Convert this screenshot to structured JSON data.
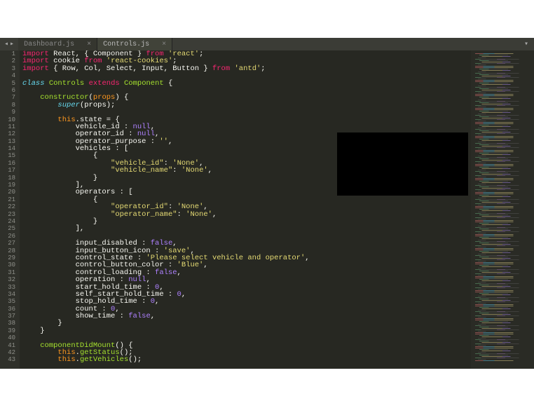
{
  "topbar": {
    "nav_left": "◂",
    "nav_right": "▸",
    "menu_icon": "▾"
  },
  "tabs": [
    {
      "label": "Dashboard.js",
      "close": "×",
      "active": false
    },
    {
      "label": "Controls.js",
      "close": "×",
      "active": true
    }
  ],
  "gutter_start": 1,
  "gutter_end": 43,
  "code_lines": [
    [
      [
        "kw",
        "import"
      ],
      [
        "punc",
        " React, { Component } "
      ],
      [
        "kw",
        "from"
      ],
      [
        "punc",
        " "
      ],
      [
        "str",
        "'react'"
      ],
      [
        "punc",
        ";"
      ]
    ],
    [
      [
        "kw",
        "import"
      ],
      [
        "punc",
        " cookie "
      ],
      [
        "kw",
        "from"
      ],
      [
        "punc",
        " "
      ],
      [
        "str",
        "'react-cookies'"
      ],
      [
        "punc",
        ";"
      ]
    ],
    [
      [
        "kw",
        "import"
      ],
      [
        "punc",
        " { Row, Col, Select, Input, Button } "
      ],
      [
        "kw",
        "from"
      ],
      [
        "punc",
        " "
      ],
      [
        "str",
        "'antd'"
      ],
      [
        "punc",
        ";"
      ]
    ],
    [],
    [
      [
        "kw2",
        "class"
      ],
      [
        "punc",
        " "
      ],
      [
        "cls",
        "Controls"
      ],
      [
        "punc",
        " "
      ],
      [
        "kw",
        "extends"
      ],
      [
        "punc",
        " "
      ],
      [
        "cls",
        "Component"
      ],
      [
        "punc",
        " {"
      ]
    ],
    [],
    [
      [
        "punc",
        "    "
      ],
      [
        "fnname",
        "constructor"
      ],
      [
        "punc",
        "("
      ],
      [
        "this",
        "props"
      ],
      [
        "punc",
        ") {"
      ]
    ],
    [
      [
        "punc",
        "        "
      ],
      [
        "kw2",
        "super"
      ],
      [
        "punc",
        "(props);"
      ]
    ],
    [],
    [
      [
        "punc",
        "        "
      ],
      [
        "this",
        "this"
      ],
      [
        "punc",
        ".state = {"
      ]
    ],
    [
      [
        "punc",
        "            vehicle_id : "
      ],
      [
        "bool",
        "null"
      ],
      [
        "punc",
        ","
      ]
    ],
    [
      [
        "punc",
        "            operator_id : "
      ],
      [
        "bool",
        "null"
      ],
      [
        "punc",
        ","
      ]
    ],
    [
      [
        "punc",
        "            operator_purpose : "
      ],
      [
        "str",
        "''"
      ],
      [
        "punc",
        ","
      ]
    ],
    [
      [
        "punc",
        "            vehicles : ["
      ]
    ],
    [
      [
        "punc",
        "                {"
      ]
    ],
    [
      [
        "punc",
        "                    "
      ],
      [
        "str",
        "\"vehicle_id\""
      ],
      [
        "punc",
        ": "
      ],
      [
        "str",
        "'None'"
      ],
      [
        "punc",
        ","
      ]
    ],
    [
      [
        "punc",
        "                    "
      ],
      [
        "str",
        "\"vehicle_name\""
      ],
      [
        "punc",
        ": "
      ],
      [
        "str",
        "'None'"
      ],
      [
        "punc",
        ","
      ]
    ],
    [
      [
        "punc",
        "                }"
      ]
    ],
    [
      [
        "punc",
        "            ],"
      ]
    ],
    [
      [
        "punc",
        "            operators : ["
      ]
    ],
    [
      [
        "punc",
        "                {"
      ]
    ],
    [
      [
        "punc",
        "                    "
      ],
      [
        "str",
        "\"operator_id\""
      ],
      [
        "punc",
        ": "
      ],
      [
        "str",
        "'None'"
      ],
      [
        "punc",
        ","
      ]
    ],
    [
      [
        "punc",
        "                    "
      ],
      [
        "str",
        "\"operator_name\""
      ],
      [
        "punc",
        ": "
      ],
      [
        "str",
        "'None'"
      ],
      [
        "punc",
        ","
      ]
    ],
    [
      [
        "punc",
        "                }"
      ]
    ],
    [
      [
        "punc",
        "            ],"
      ]
    ],
    [],
    [
      [
        "punc",
        "            input_disabled : "
      ],
      [
        "bool",
        "false"
      ],
      [
        "punc",
        ","
      ]
    ],
    [
      [
        "punc",
        "            input_button_icon : "
      ],
      [
        "str",
        "'save'"
      ],
      [
        "punc",
        ","
      ]
    ],
    [
      [
        "punc",
        "            control_state : "
      ],
      [
        "str",
        "'Please select vehicle and operator'"
      ],
      [
        "punc",
        ","
      ]
    ],
    [
      [
        "punc",
        "            control_button_color : "
      ],
      [
        "str",
        "'Blue'"
      ],
      [
        "punc",
        ","
      ]
    ],
    [
      [
        "punc",
        "            control_loading : "
      ],
      [
        "bool",
        "false"
      ],
      [
        "punc",
        ","
      ]
    ],
    [
      [
        "punc",
        "            operation : "
      ],
      [
        "bool",
        "null"
      ],
      [
        "punc",
        ","
      ]
    ],
    [
      [
        "punc",
        "            start_hold_time : "
      ],
      [
        "num",
        "0"
      ],
      [
        "punc",
        ","
      ]
    ],
    [
      [
        "punc",
        "            self_start_hold_time : "
      ],
      [
        "num",
        "0"
      ],
      [
        "punc",
        ","
      ]
    ],
    [
      [
        "punc",
        "            stop_hold_time : "
      ],
      [
        "num",
        "0"
      ],
      [
        "punc",
        ","
      ]
    ],
    [
      [
        "punc",
        "            count : "
      ],
      [
        "num",
        "0"
      ],
      [
        "punc",
        ","
      ]
    ],
    [
      [
        "punc",
        "            show_time : "
      ],
      [
        "bool",
        "false"
      ],
      [
        "punc",
        ","
      ]
    ],
    [
      [
        "punc",
        "        }"
      ]
    ],
    [
      [
        "punc",
        "    }"
      ]
    ],
    [],
    [
      [
        "punc",
        "    "
      ],
      [
        "fnname",
        "componentDidMount"
      ],
      [
        "punc",
        "() {"
      ]
    ],
    [
      [
        "punc",
        "        "
      ],
      [
        "this",
        "this"
      ],
      [
        "punc",
        "."
      ],
      [
        "fnname",
        "getStatus"
      ],
      [
        "punc",
        "();"
      ]
    ],
    [
      [
        "punc",
        "        "
      ],
      [
        "this",
        "this"
      ],
      [
        "punc",
        "."
      ],
      [
        "fnname",
        "getVehicles"
      ],
      [
        "punc",
        "();"
      ]
    ]
  ]
}
